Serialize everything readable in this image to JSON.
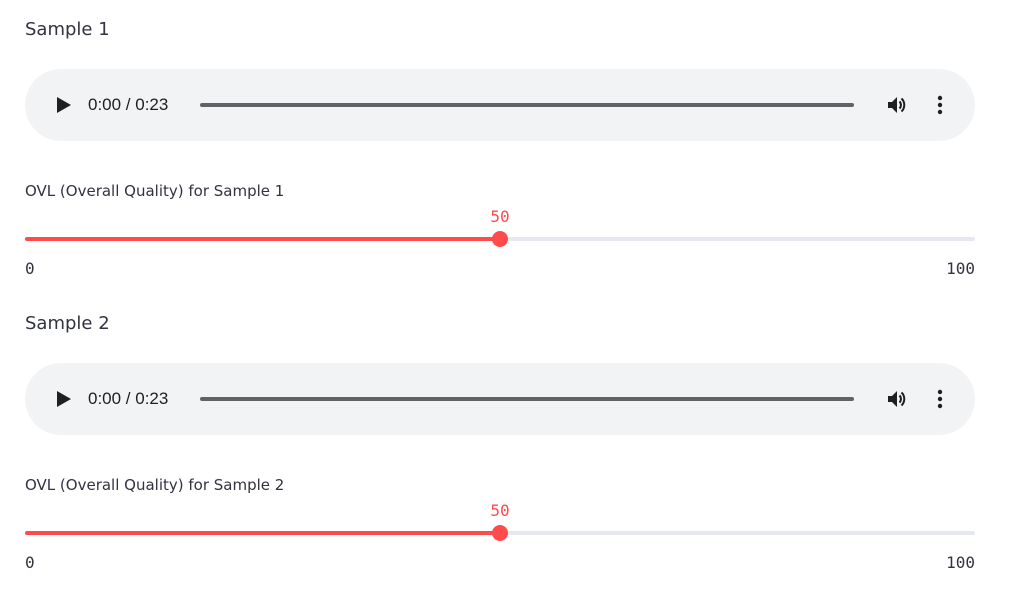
{
  "samples": [
    {
      "title": "Sample 1",
      "audio": {
        "time": "0:00 / 0:23",
        "icons": [
          "play-icon",
          "volume-icon",
          "more-vert-icon"
        ]
      },
      "slider": {
        "label": "OVL (Overall Quality) for Sample 1",
        "value": "50",
        "min": "0",
        "max": "100",
        "level": 0.5
      }
    },
    {
      "title": "Sample 2",
      "audio": {
        "time": "0:00 / 0:23",
        "icons": [
          "play-icon",
          "volume-icon",
          "more-vert-icon"
        ]
      },
      "slider": {
        "label": "OVL (Overall Quality) for Sample 2",
        "value": "50",
        "min": "0",
        "max": "100",
        "level": 0.5
      }
    }
  ],
  "colors": {
    "accent": "#ff4b4b",
    "rail": "#e6e8ef",
    "player_bg": "#f1f3f4",
    "text": "#31333f"
  }
}
